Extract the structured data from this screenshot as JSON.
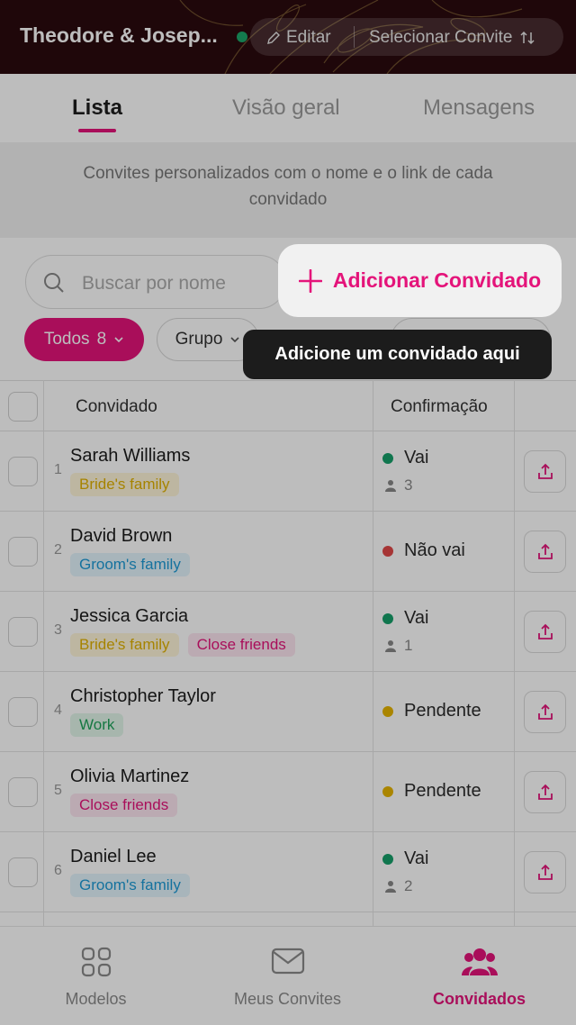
{
  "header": {
    "title": "Theodore & Josep...",
    "edit_label": "Editar",
    "select_label": "Selecionar Convite"
  },
  "tabs": [
    {
      "label": "Lista",
      "active": true
    },
    {
      "label": "Visão geral",
      "active": false
    },
    {
      "label": "Mensagens",
      "active": false
    }
  ],
  "info_text": "Convites personalizados com o nome e o link de cada convidado",
  "search": {
    "placeholder": "Buscar por nome"
  },
  "add_button": {
    "label": "Adicionar Convidado"
  },
  "filters": {
    "todos_label": "Todos",
    "todos_count": "8",
    "grupo_label": "Grupo"
  },
  "tooltip": "Adicione um convidado aqui",
  "table": {
    "col_guest": "Convidado",
    "col_confirm": "Confirmação",
    "rows": [
      {
        "num": "1",
        "name": "Sarah Williams",
        "tags": [
          {
            "label": "Bride's family",
            "kind": "bride"
          }
        ],
        "status": "Vai",
        "status_color": "#16a06a",
        "count": "3"
      },
      {
        "num": "2",
        "name": "David Brown",
        "tags": [
          {
            "label": "Groom's family",
            "kind": "groom"
          }
        ],
        "status": "Não vai",
        "status_color": "#e04848",
        "count": ""
      },
      {
        "num": "3",
        "name": "Jessica Garcia",
        "tags": [
          {
            "label": "Bride's family",
            "kind": "bride"
          },
          {
            "label": "Close friends",
            "kind": "close"
          }
        ],
        "status": "Vai",
        "status_color": "#16a06a",
        "count": "1"
      },
      {
        "num": "4",
        "name": "Christopher Taylor",
        "tags": [
          {
            "label": "Work",
            "kind": "work"
          }
        ],
        "status": "Pendente",
        "status_color": "#e6b400",
        "count": ""
      },
      {
        "num": "5",
        "name": "Olivia Martinez",
        "tags": [
          {
            "label": "Close friends",
            "kind": "close"
          }
        ],
        "status": "Pendente",
        "status_color": "#e6b400",
        "count": ""
      },
      {
        "num": "6",
        "name": "Daniel Lee",
        "tags": [
          {
            "label": "Groom's family",
            "kind": "groom"
          }
        ],
        "status": "Vai",
        "status_color": "#16a06a",
        "count": "2"
      }
    ]
  },
  "nav": [
    {
      "label": "Modelos",
      "icon": "grid-icon",
      "active": false
    },
    {
      "label": "Meus Convites",
      "icon": "envelope-icon",
      "active": false
    },
    {
      "label": "Convidados",
      "icon": "people-icon",
      "active": true
    }
  ],
  "colors": {
    "accent": "#e4147a",
    "header_bg": "#2a0a0e"
  }
}
